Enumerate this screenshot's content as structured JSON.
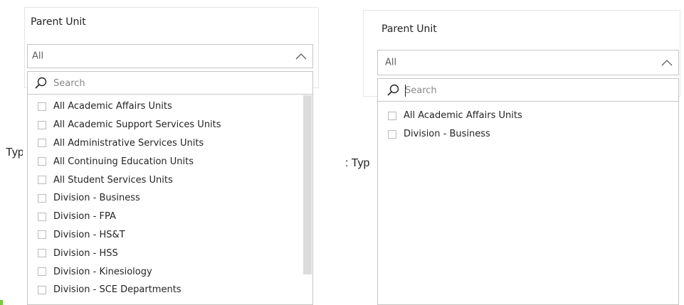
{
  "left_panel": {
    "title": "Parent Unit",
    "selected_value": "All",
    "search": {
      "placeholder": "Search",
      "value": ""
    },
    "background_label": "Typ",
    "items": [
      "All Academic Affairs Units",
      "All Academic Support Services Units",
      "All Administrative Services Units",
      "All Continuing Education Units",
      "All Student Services Units",
      "Division - Business",
      "Division - FPA",
      "Division - HS&T",
      "Division - HSS",
      "Division - Kinesiology",
      "Division - SCE Departments"
    ]
  },
  "right_panel": {
    "title": "Parent Unit",
    "selected_value": "All",
    "search": {
      "placeholder": "Search",
      "value": ""
    },
    "background_label": ": Typ",
    "items": [
      "All Academic Affairs Units",
      "Division - Business"
    ]
  },
  "icons": {
    "chevron": "chevron-up-icon",
    "search": "search-icon",
    "checkbox": "checkbox-icon"
  },
  "colors": {
    "border": "#c8c6c4",
    "text": "#252423",
    "placeholder": "#8a8886",
    "scrollbar": "#dcdcdc",
    "accent": "#7bc843"
  }
}
